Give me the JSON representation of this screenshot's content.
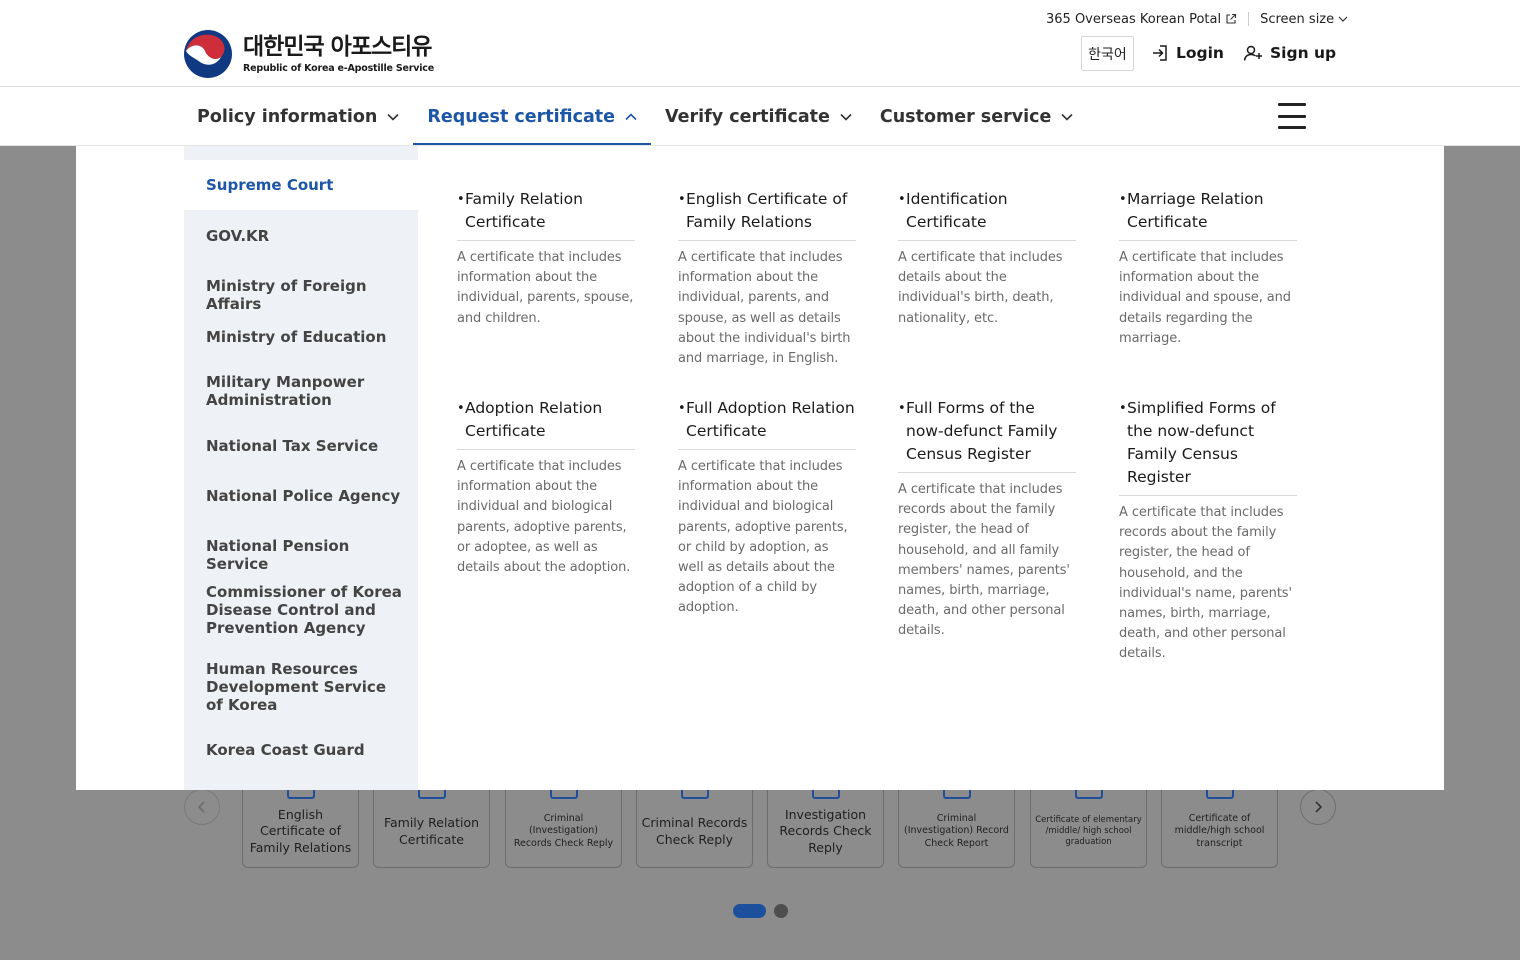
{
  "header": {
    "logo_ko": "대한민국 아포스티유",
    "logo_en": "Republic of Korea e-Apostille Service",
    "portal_link": "365 Overseas Korean Potal",
    "screen_size": "Screen size",
    "language": "한국어",
    "login": "Login",
    "signup": "Sign up"
  },
  "nav": {
    "items": [
      {
        "label": "Policy information"
      },
      {
        "label": "Request certificate"
      },
      {
        "label": "Verify certificate"
      },
      {
        "label": "Customer service"
      }
    ],
    "active_index": 1
  },
  "sidebar": {
    "items": [
      {
        "label": "Supreme Court"
      },
      {
        "label": "GOV.KR"
      },
      {
        "label": "Ministry of Foreign Affairs"
      },
      {
        "label": "Ministry of Education"
      },
      {
        "label": "Military Manpower Administration"
      },
      {
        "label": "National Tax Service"
      },
      {
        "label": "National Police Agency"
      },
      {
        "label": "National Pension Service"
      },
      {
        "label": "Commissioner of Korea Disease Control and Prevention Agency"
      },
      {
        "label": "Human Resources Development Service of Korea"
      },
      {
        "label": "Korea Coast Guard"
      }
    ],
    "active_index": 0
  },
  "certificates": [
    {
      "title": "Family Relation Certificate",
      "desc": "A certificate that includes information about the individual, parents, spouse, and children."
    },
    {
      "title": "English Certificate of Family Relations",
      "desc": "A certificate that includes information about the individual, parents, and spouse, as well as details about the individual's birth and marriage, in English."
    },
    {
      "title": "Identification Certificate",
      "desc": "A certificate that includes details about the individual's birth, death, nationality, etc."
    },
    {
      "title": "Marriage Relation Certificate",
      "desc": "A certificate that includes information about the individual and spouse, and details regarding the marriage."
    },
    {
      "title": "Adoption Relation Certificate",
      "desc": "A certificate that includes information about the individual and biological parents, adoptive parents, or adoptee, as well as details about the adoption."
    },
    {
      "title": "Full Adoption Relation Certificate",
      "desc": "A certificate that includes information about the individual and biological parents, adoptive parents, or child by adoption, as well as details about the adoption of a child by adoption."
    },
    {
      "title": "Full Forms of the now-defunct Family Census Register",
      "desc": "A certificate that includes records about the family register, the head of household, and all family members' names, parents' names, birth, marriage, death, and other personal details."
    },
    {
      "title": "Simplified Forms of the now-defunct Family Census Register",
      "desc": "A certificate that includes records about the family register, the head of household, and the individual's name, parents' names, birth, marriage, death, and other personal details."
    }
  ],
  "carousel": {
    "cards": [
      {
        "label": "English Certificate of Family Relations",
        "icon": "document-icon"
      },
      {
        "label": "Family Relation Certificate",
        "icon": "family-icon"
      },
      {
        "label": "Criminal (Investigation) Records Check Reply",
        "icon": "monitor-icon"
      },
      {
        "label": "Criminal Records Check Reply",
        "icon": "monitor-icon"
      },
      {
        "label": "Investigation Records Check Reply",
        "icon": "monitor-icon"
      },
      {
        "label": "Criminal (Investigation) Record Check Report",
        "icon": "monitor-icon"
      },
      {
        "label": "Certificate of elementary /middle/ high school graduation",
        "icon": "document-icon"
      },
      {
        "label": "Certificate of middle/high school transcript",
        "icon": "document-icon"
      }
    ],
    "page_count": 2,
    "active_page": 1
  },
  "colors": {
    "accent": "#1d56a6",
    "sidebar_bg": "#eef1f6",
    "dim_overlay": "#8c8c8c",
    "emblem_red": "#cd2e3a",
    "emblem_blue": "#0f3a82"
  }
}
